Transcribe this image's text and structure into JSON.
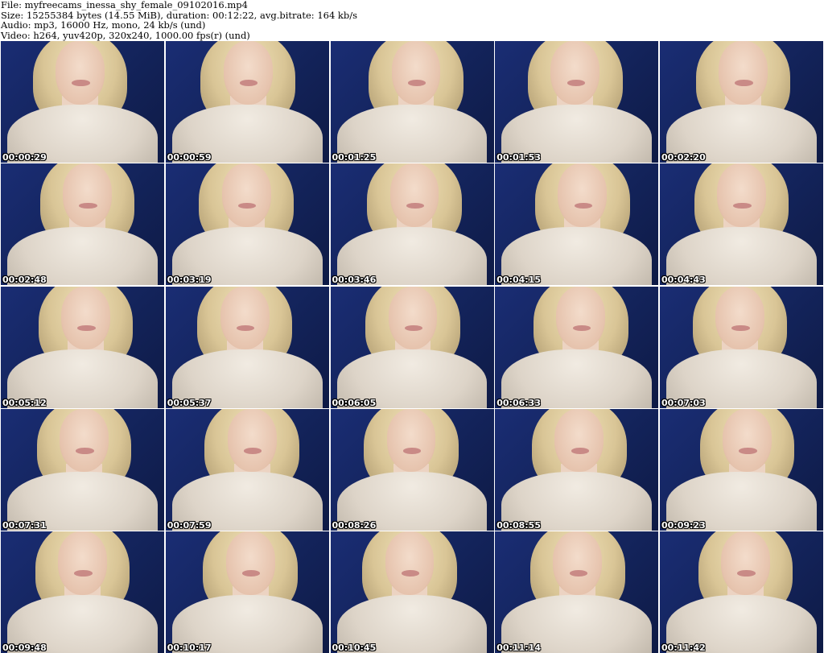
{
  "header": {
    "file": "File: myfreecams_inessa_shy_female_09102016.mp4",
    "size": "Size: 15255384 bytes (14.55 MiB), duration: 00:12:22, avg.bitrate: 164 kb/s",
    "audio": "Audio: mp3, 16000 Hz, mono, 24 kb/s (und)",
    "video": "Video: h264, yuv420p, 320x240, 1000.00 fps(r) (und)"
  },
  "thumbnails": [
    "00:00:29",
    "00:00:59",
    "00:01:25",
    "00:01:53",
    "00:02:20",
    "00:02:48",
    "00:03:19",
    "00:03:46",
    "00:04:15",
    "00:04:43",
    "00:05:12",
    "00:05:37",
    "00:06:05",
    "00:06:33",
    "00:07:03",
    "00:07:31",
    "00:07:59",
    "00:08:26",
    "00:08:55",
    "00:09:23",
    "00:09:48",
    "00:10:17",
    "00:10:45",
    "00:11:14",
    "00:11:42"
  ]
}
